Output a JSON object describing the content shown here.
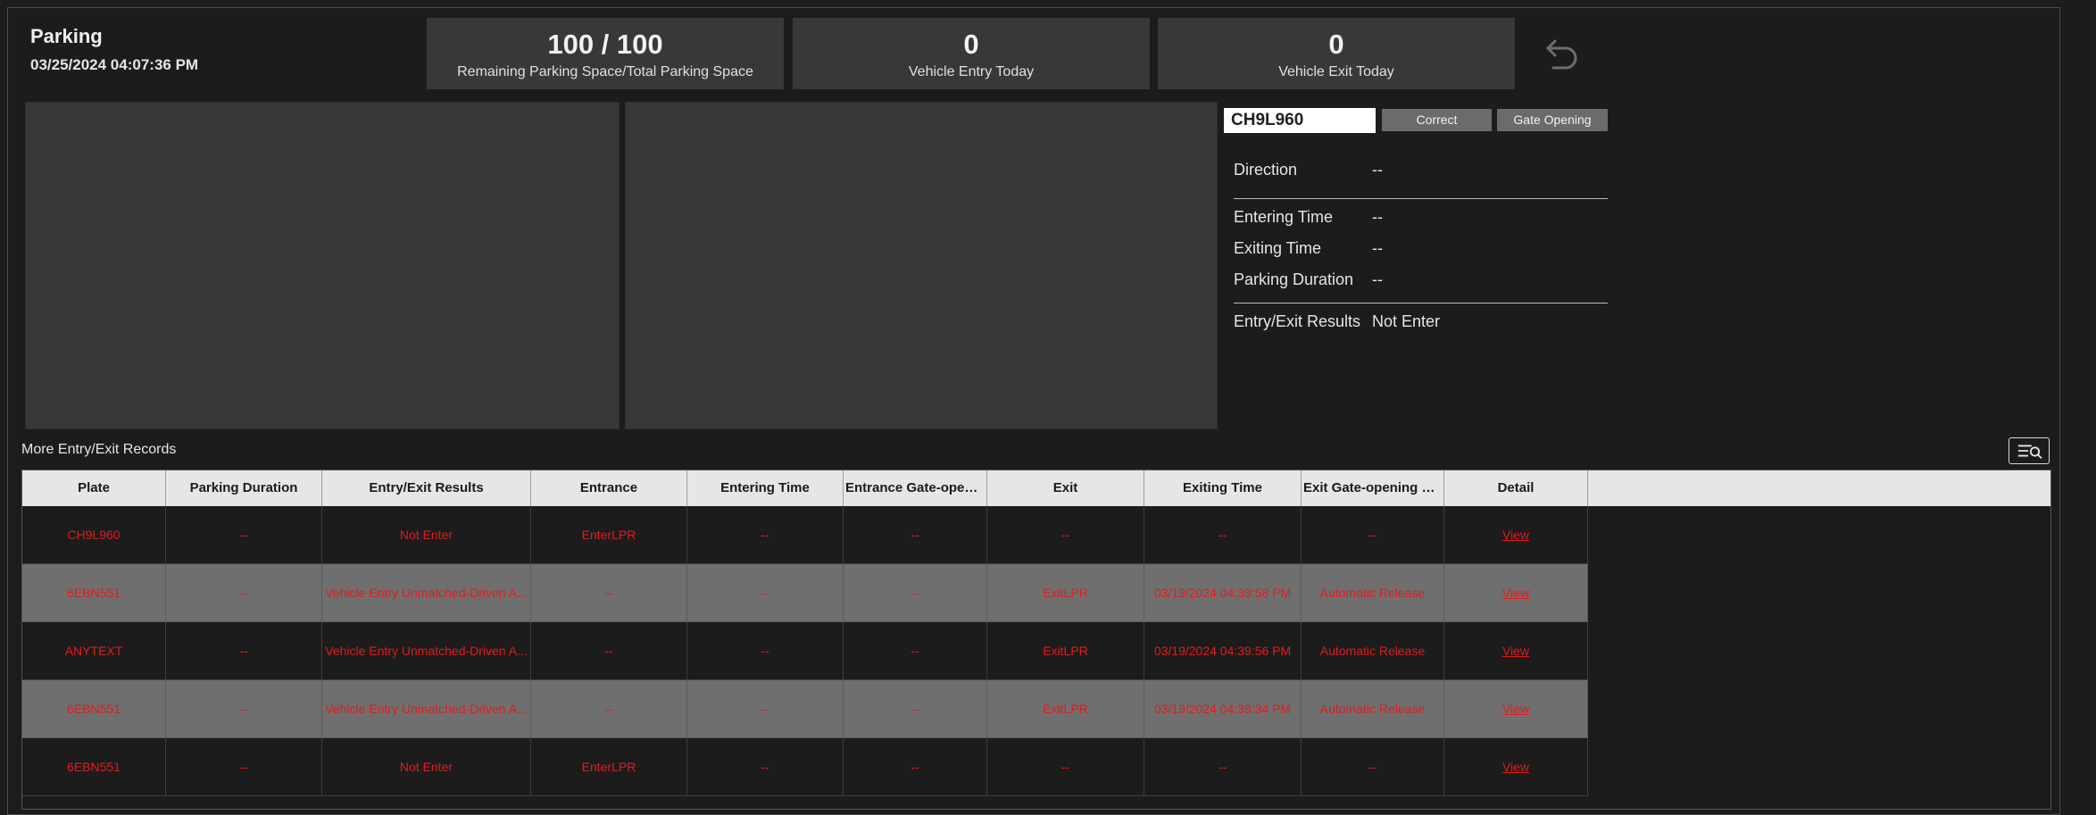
{
  "header": {
    "title": "Parking",
    "datetime": "03/25/2024 04:07:36 PM"
  },
  "stats": [
    {
      "value": "100 / 100",
      "label": "Remaining Parking Space/Total Parking Space"
    },
    {
      "value": "0",
      "label": "Vehicle Entry Today"
    },
    {
      "value": "0",
      "label": "Vehicle Exit Today"
    }
  ],
  "icons": {
    "undo": "undo-icon",
    "records_search": "list-search-icon"
  },
  "detail": {
    "plate_value": "CH9L960",
    "correct_label": "Correct",
    "gate_opening_label": "Gate Opening",
    "direction_label": "Direction",
    "direction_value": "--",
    "entering_time_label": "Entering Time",
    "entering_time_value": "--",
    "exiting_time_label": "Exiting Time",
    "exiting_time_value": "--",
    "parking_duration_label": "Parking Duration",
    "parking_duration_value": "--",
    "results_label": "Entry/Exit Results",
    "results_value": "Not Enter"
  },
  "records": {
    "title": "More Entry/Exit Records",
    "columns": [
      "Plate",
      "Parking Duration",
      "Entry/Exit Results",
      "Entrance",
      "Entering Time",
      "Entrance Gate-openin...",
      "Exit",
      "Exiting Time",
      "Exit Gate-opening Way",
      "Detail"
    ],
    "rows": [
      [
        "CH9L960",
        "--",
        "Not Enter",
        "EnterLPR",
        "--",
        "--",
        "--",
        "--",
        "--",
        "View"
      ],
      [
        "6EBN551",
        "--",
        "Vehicle Entry Unmatched-Driven A...",
        "--",
        "--",
        "--",
        "ExitLPR",
        "03/19/2024 04:39:58 PM",
        "Automatic Release",
        "View"
      ],
      [
        "ANYTEXT",
        "--",
        "Vehicle Entry Unmatched-Driven A...",
        "--",
        "--",
        "--",
        "ExitLPR",
        "03/19/2024 04:39:56 PM",
        "Automatic Release",
        "View"
      ],
      [
        "6EBN551",
        "--",
        "Vehicle Entry Unmatched-Driven A...",
        "--",
        "--",
        "--",
        "ExitLPR",
        "03/19/2024 04:39:34 PM",
        "Automatic Release",
        "View"
      ],
      [
        "6EBN551",
        "--",
        "Not Enter",
        "EnterLPR",
        "--",
        "--",
        "--",
        "--",
        "--",
        "View"
      ]
    ]
  },
  "colors": {
    "background": "#1c1c1c",
    "card": "#383838",
    "record_text": "#e31b1b",
    "header_row": "#e6e6e6",
    "alt_row": "#6f6f6f"
  }
}
